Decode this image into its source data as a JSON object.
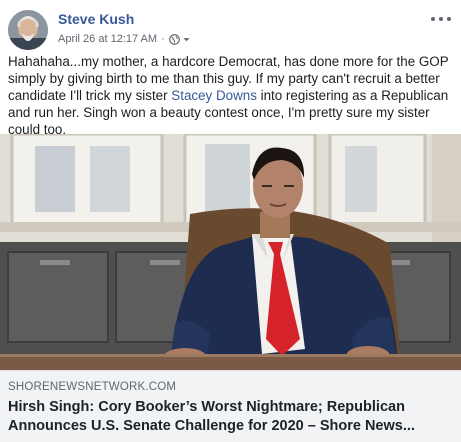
{
  "post": {
    "author": "Steve Kush",
    "timestamp": "April 26 at 12:17 AM",
    "separator": "·",
    "privacy_icon": "globe-icon",
    "audience_caret_icon": "caret-down-icon",
    "more_icon": "more-options-icon",
    "text_before_mention": "Hahahaha...my mother, a hardcore Democrat, has done more for the GOP simply by giving birth to me than this guy. If my party can't recruit a better candidate I'll trick my sister ",
    "mention": "Stacey Downs",
    "text_after_mention": " into registering as a Republican and run her. Singh won a beauty contest once, I'm pretty sure my sister could too."
  },
  "link_preview": {
    "domain": "SHORENEWSNETWORK.COM",
    "headline": "Hirsh Singh: Cory Booker’s Worst Nightmare; Republican Announces U.S. Senate Challenge for 2020 – Shore News..."
  },
  "colors": {
    "link": "#385898",
    "meta": "#606770",
    "preview_bg": "#f2f3f5",
    "tie": "#d6232a",
    "suit": "#1e2d4f"
  }
}
